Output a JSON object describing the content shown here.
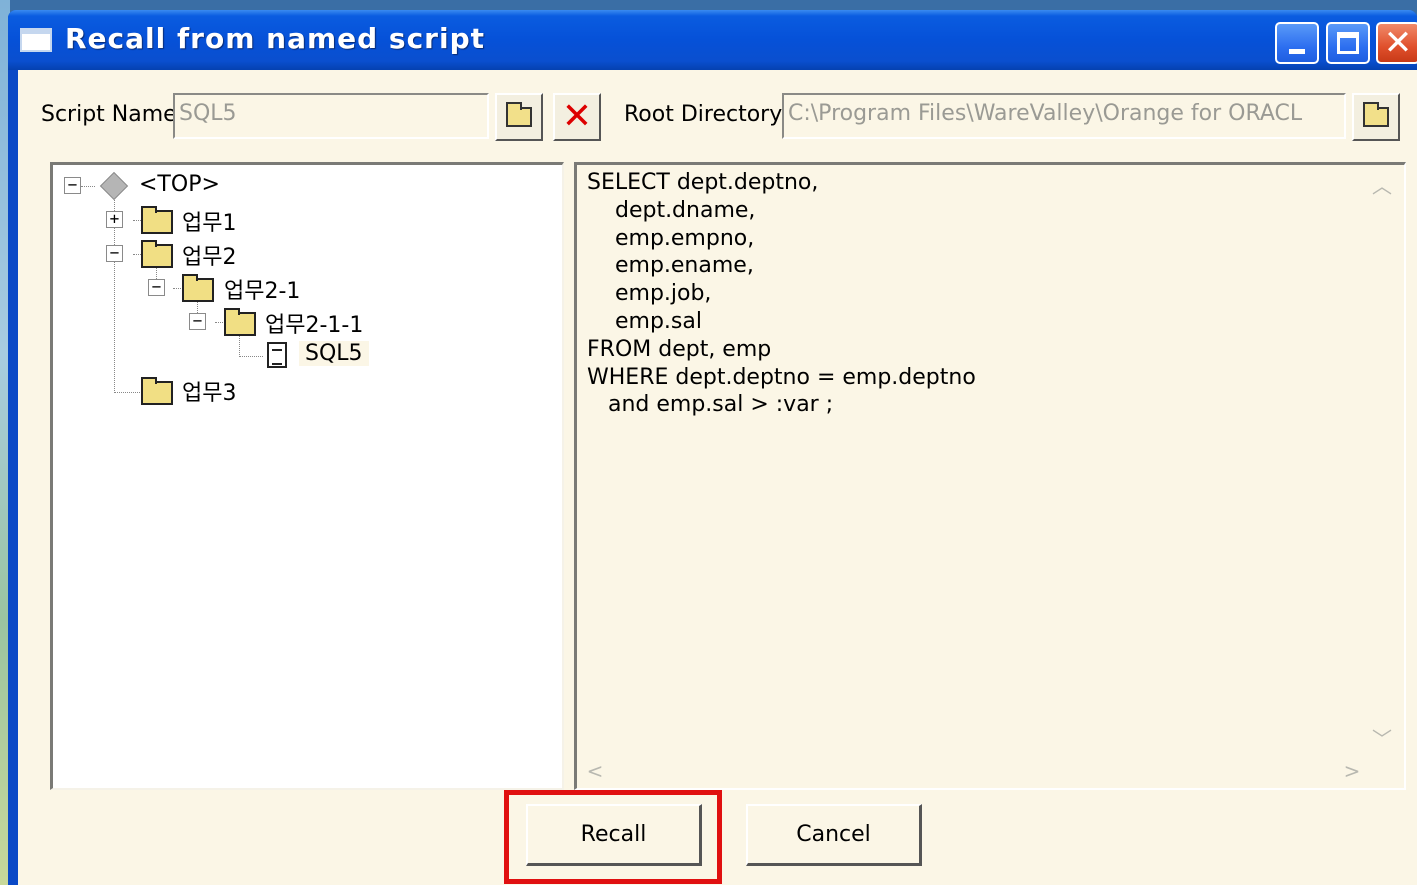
{
  "window": {
    "title": "Recall from named script"
  },
  "toolbar": {
    "script_name_label": "Script Name",
    "script_name_value": "SQL5",
    "root_directory_label": "Root Directory",
    "root_directory_value": "C:\\Program Files\\WareValley\\Orange for ORACL"
  },
  "tree": {
    "nodes": [
      {
        "label": "<TOP>",
        "expander": "−"
      },
      {
        "label": "업무1",
        "expander": "+"
      },
      {
        "label": "업무2",
        "expander": "−"
      },
      {
        "label": "업무2-1",
        "expander": "−"
      },
      {
        "label": "업무2-1-1",
        "expander": "−"
      },
      {
        "label": "SQL5",
        "selected": true
      },
      {
        "label": "업무3"
      }
    ]
  },
  "script_text": "SELECT dept.deptno,\n    dept.dname,\n    emp.empno,\n    emp.ename,\n    emp.job,\n    emp.sal\nFROM dept, emp\nWHERE dept.deptno = emp.deptno\n   and emp.sal > :var ;",
  "buttons": {
    "recall": "Recall",
    "cancel": "Cancel"
  },
  "colors": {
    "titlebar": "#0651d8",
    "client": "#fbf6e6",
    "highlight": "#e01010"
  }
}
